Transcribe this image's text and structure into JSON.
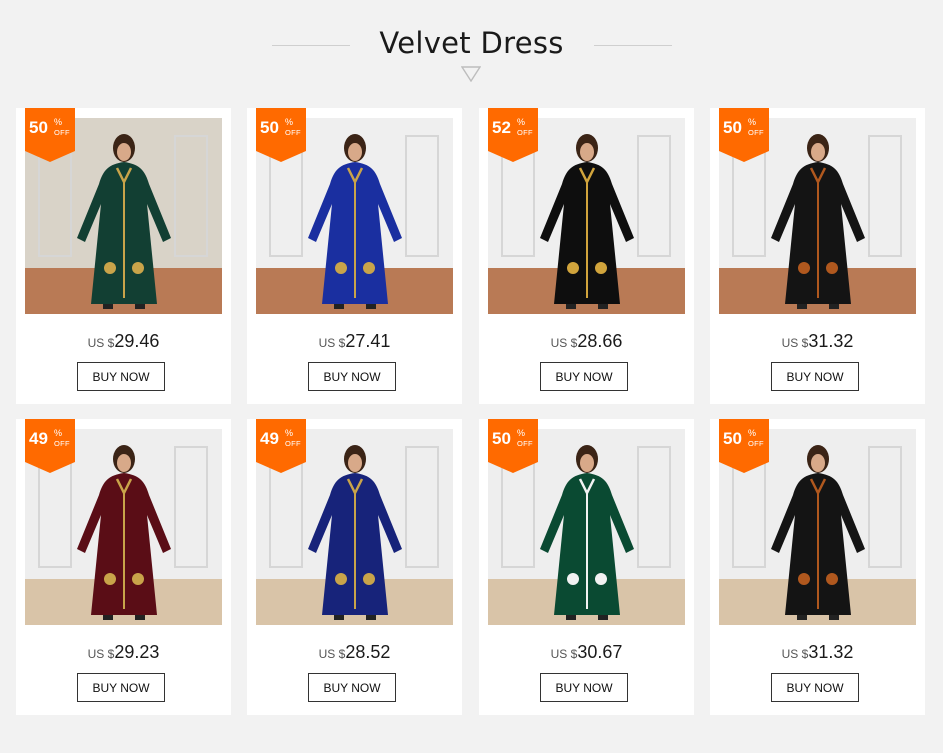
{
  "section": {
    "title": "Velvet Dress"
  },
  "products": [
    {
      "discount": "50",
      "percent_symbol": "%",
      "off_label": "OFF",
      "currency": "US $",
      "price": "29.46",
      "buy_label": "BUY NOW",
      "dress_color": "#123f33",
      "accent": "#c9a44a",
      "bg": "#d9d3c8"
    },
    {
      "discount": "50",
      "percent_symbol": "%",
      "off_label": "OFF",
      "currency": "US $",
      "price": "27.41",
      "buy_label": "BUY NOW",
      "dress_color": "#1a2fa0",
      "accent": "#c9a44a",
      "bg": "#efefef"
    },
    {
      "discount": "52",
      "percent_symbol": "%",
      "off_label": "OFF",
      "currency": "US $",
      "price": "28.66",
      "buy_label": "BUY NOW",
      "dress_color": "#0e0e0e",
      "accent": "#d1a43c",
      "bg": "#efefef"
    },
    {
      "discount": "50",
      "percent_symbol": "%",
      "off_label": "OFF",
      "currency": "US $",
      "price": "31.32",
      "buy_label": "BUY NOW",
      "dress_color": "#141414",
      "accent": "#b0581e",
      "bg": "#efefef"
    },
    {
      "discount": "49",
      "percent_symbol": "%",
      "off_label": "OFF",
      "currency": "US $",
      "price": "29.23",
      "buy_label": "BUY NOW",
      "dress_color": "#5a0d16",
      "accent": "#c9a44a",
      "bg": "#eeeeee"
    },
    {
      "discount": "49",
      "percent_symbol": "%",
      "off_label": "OFF",
      "currency": "US $",
      "price": "28.52",
      "buy_label": "BUY NOW",
      "dress_color": "#17237a",
      "accent": "#c9a44a",
      "bg": "#eeeeee"
    },
    {
      "discount": "50",
      "percent_symbol": "%",
      "off_label": "OFF",
      "currency": "US $",
      "price": "30.67",
      "buy_label": "BUY NOW",
      "dress_color": "#0a4a32",
      "accent": "#f2f2f2",
      "bg": "#eeeeee"
    },
    {
      "discount": "50",
      "percent_symbol": "%",
      "off_label": "OFF",
      "currency": "US $",
      "price": "31.32",
      "buy_label": "BUY NOW",
      "dress_color": "#141414",
      "accent": "#b0581e",
      "bg": "#eeeeee"
    }
  ],
  "colors": {
    "badge": "#ff6a00",
    "page_bg": "#f2f2f2",
    "card_bg": "#ffffff"
  }
}
